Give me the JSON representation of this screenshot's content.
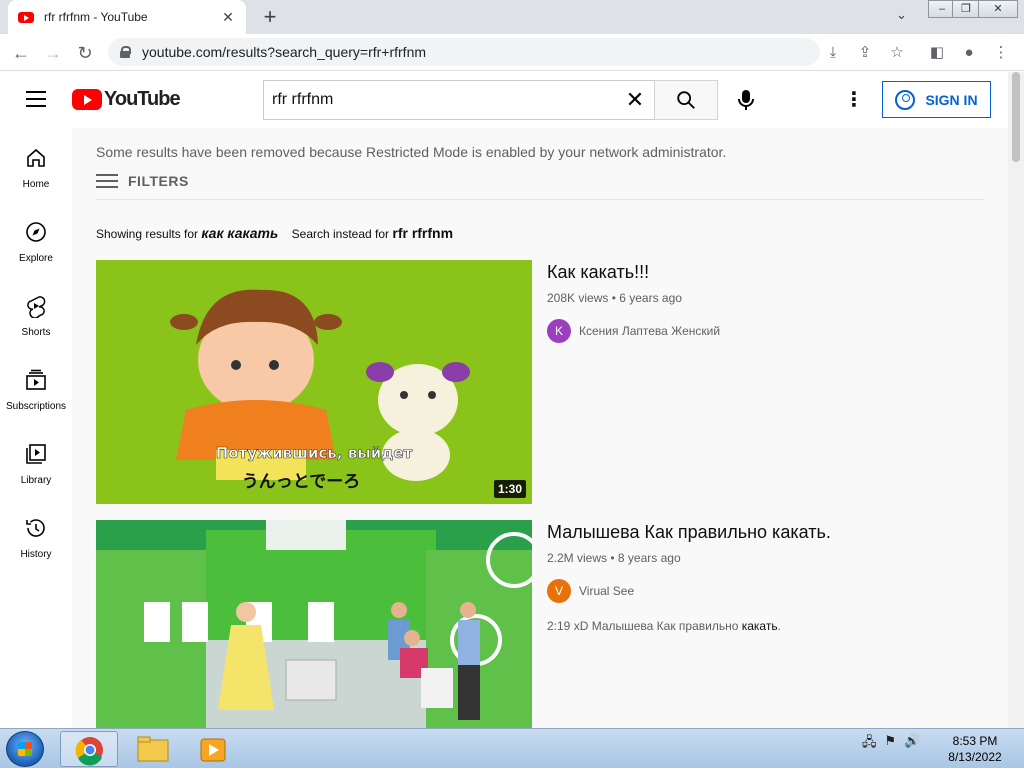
{
  "browser": {
    "tab_title": "rfr rfrfnm - YouTube",
    "new_tab": "+",
    "url": "youtube.com/results?search_query=rfr+rfrfnm"
  },
  "youtube": {
    "brand": "YouTube",
    "search_value": "rfr rfrfnm",
    "search_placeholder": "Search",
    "sign_in": "SIGN IN",
    "guide": [
      {
        "label": "Home",
        "icon": "home-icon"
      },
      {
        "label": "Explore",
        "icon": "compass-icon"
      },
      {
        "label": "Shorts",
        "icon": "shorts-icon"
      },
      {
        "label": "Subscriptions",
        "icon": "subscriptions-icon"
      },
      {
        "label": "Library",
        "icon": "library-icon"
      },
      {
        "label": "History",
        "icon": "history-icon"
      }
    ],
    "notice": "Some results have been removed because Restricted Mode is enabled by your network administrator.",
    "filters": "FILTERS",
    "showing_prefix": "Showing results for",
    "showing_query": "как какать",
    "instead_prefix": "Search instead for",
    "instead_query": "rfr rfrfnm",
    "videos": [
      {
        "title": "Как какать!!!",
        "views": "208K views",
        "age": "6 years ago",
        "channel": "Ксения Лаптева Женский",
        "avatar_letter": "K",
        "avatar_color": "#9c3fbf",
        "duration": "1:30",
        "caption_ru": "Потужившись, выйдет",
        "caption_jp": "うんっとでーろ",
        "desc_prefix": "",
        "desc_bold": ""
      },
      {
        "title": "Малышева Как правильно какать.",
        "views": "2.2M views",
        "age": "8 years ago",
        "channel": "Virual See",
        "avatar_letter": "V",
        "avatar_color": "#e8710a",
        "duration": "",
        "desc_prefix": "2:19 xD Малышева Как правильно ",
        "desc_bold": "какать",
        "desc_suffix": "."
      }
    ]
  },
  "taskbar": {
    "time": "8:53 PM",
    "date": "8/13/2022"
  }
}
